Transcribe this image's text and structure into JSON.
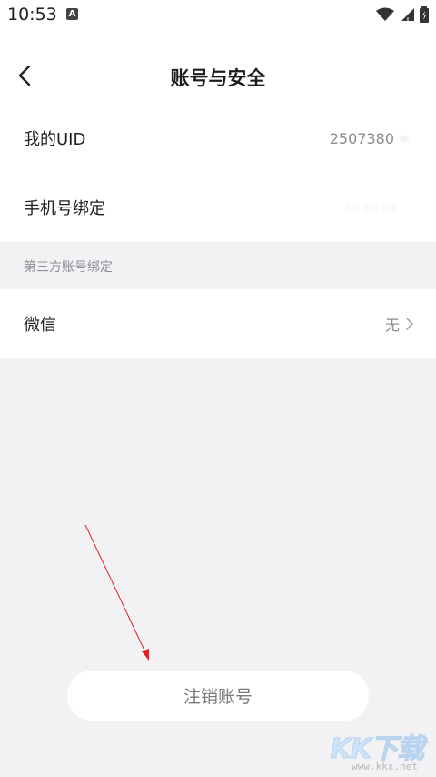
{
  "status_bar": {
    "time": "10:53",
    "notification_badge": "A"
  },
  "nav": {
    "title": "账号与安全"
  },
  "account": {
    "uid_label": "我的UID",
    "uid_value": "2507380",
    "phone_label": "手机号绑定",
    "phone_value": ""
  },
  "third_party": {
    "section_title": "第三方账号绑定",
    "wechat_label": "微信",
    "wechat_value": "无"
  },
  "actions": {
    "cancel_account_label": "注销账号"
  },
  "watermark": {
    "logo": "KK下载",
    "url": "www.kkx.net"
  },
  "colors": {
    "background": "#f2f2f5",
    "card": "#ffffff",
    "annotation_arrow": "#e02020"
  }
}
